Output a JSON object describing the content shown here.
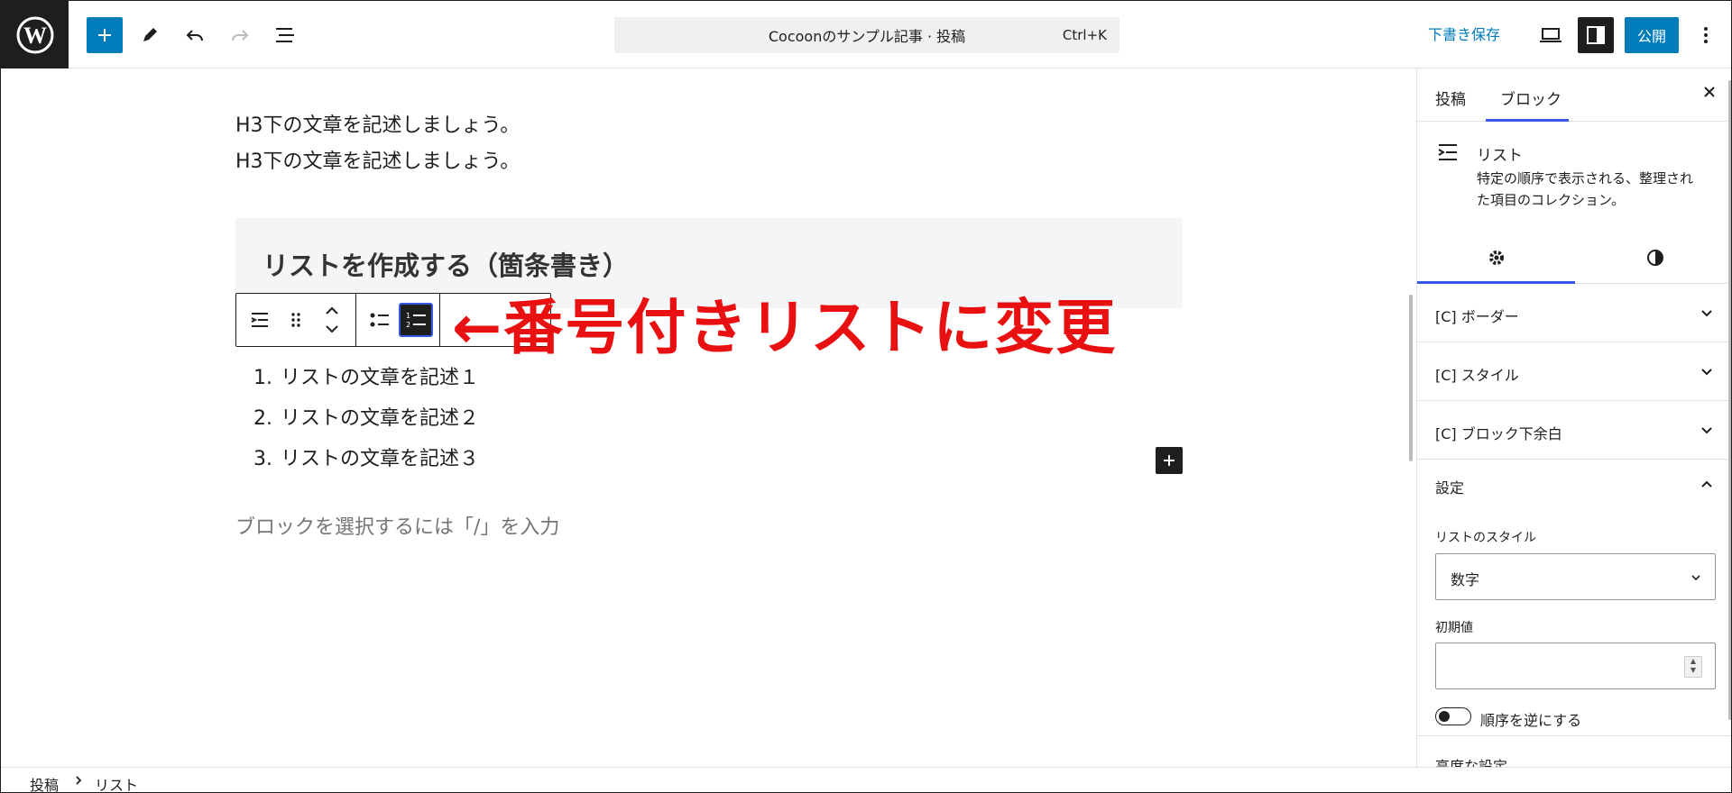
{
  "topbar": {
    "command_title": "Cocoonのサンプル記事 · 投稿",
    "command_shortcut": "Ctrl+K",
    "save_draft": "下書き保存",
    "publish": "公開",
    "icons": [
      "wordpress-logo",
      "plus-icon",
      "pencil-icon",
      "undo-icon",
      "redo-icon",
      "list-view-icon",
      "preview-icon",
      "sidebar-icon",
      "more-vertical-icon"
    ]
  },
  "editor": {
    "paragraphs": [
      "H3下の文章を記述しましょう。",
      "H3下の文章を記述しましょう。"
    ],
    "heading": "リストを作成する（箇条書き）",
    "annotation": "←番号付きリストに変更",
    "list_items": [
      {
        "num": "1.",
        "text": "リストの文章を記述１"
      },
      {
        "num": "2.",
        "text": "リストの文章を記述２"
      },
      {
        "num": "3.",
        "text": "リストの文章を記述３"
      }
    ],
    "placeholder": "ブロックを選択するには「/」を入力"
  },
  "sidebar": {
    "tabs": [
      "投稿",
      "ブロック"
    ],
    "active_tab": "ブロック",
    "block_title": "リスト",
    "block_desc": "特定の順序で表示される、整理された項目のコレクション。",
    "panels": [
      "[C] ボーダー",
      "[C] スタイル",
      "[C] ブロック下余白"
    ],
    "settings": {
      "title": "設定",
      "list_style_label": "リストのスタイル",
      "list_style_value": "数字",
      "start_label": "初期値",
      "start_value": "",
      "reverse_label": "順序を逆にする",
      "reverse_on": false
    },
    "advanced": "高度な設定"
  },
  "footer": {
    "crumbs": [
      "投稿",
      "リスト"
    ]
  },
  "colors": {
    "accent": "#007cba",
    "focus": "#3858e9",
    "annotation": "#e81010",
    "dark": "#1e1e1e"
  }
}
